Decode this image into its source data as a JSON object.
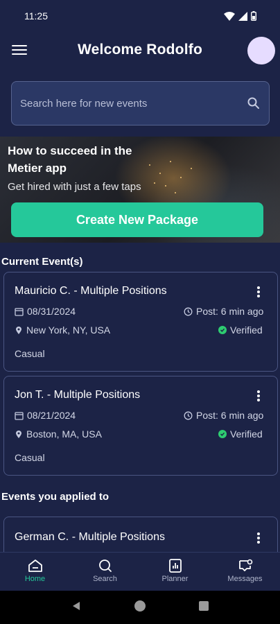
{
  "status_bar": {
    "time": "11:25"
  },
  "header": {
    "title": "Welcome Rodolfo"
  },
  "search": {
    "placeholder": "Search here for new events"
  },
  "banner": {
    "title": "How to succeed in the Metier app",
    "subtitle": "Get hired with just a few taps",
    "button_label": "Create New Package"
  },
  "sections": {
    "current": "Current Event(s)",
    "applied": "Events you applied to"
  },
  "current_events": [
    {
      "name": "Mauricio C. - Multiple Positions",
      "date": "08/31/2024",
      "posted": "Post: 6 min ago",
      "location": "New York, NY, USA",
      "status": "Verified",
      "tag": "Casual"
    },
    {
      "name": "Jon  T. - Multiple Positions",
      "date": "08/21/2024",
      "posted": "Post: 6 min ago",
      "location": "Boston, MA, USA",
      "status": "Verified",
      "tag": "Casual"
    }
  ],
  "applied_events": [
    {
      "name": "German C. - Multiple Positions"
    }
  ],
  "bottom_nav": [
    {
      "label": "Home",
      "icon": "home-icon",
      "active": true
    },
    {
      "label": "Search",
      "icon": "search-icon",
      "active": false
    },
    {
      "label": "Planner",
      "icon": "planner-icon",
      "active": false
    },
    {
      "label": "Messages",
      "icon": "messages-icon",
      "active": false
    }
  ],
  "colors": {
    "background": "#1c2346",
    "accent": "#25c89a",
    "verified": "#2ecc71",
    "avatar": "#e6dcff"
  }
}
